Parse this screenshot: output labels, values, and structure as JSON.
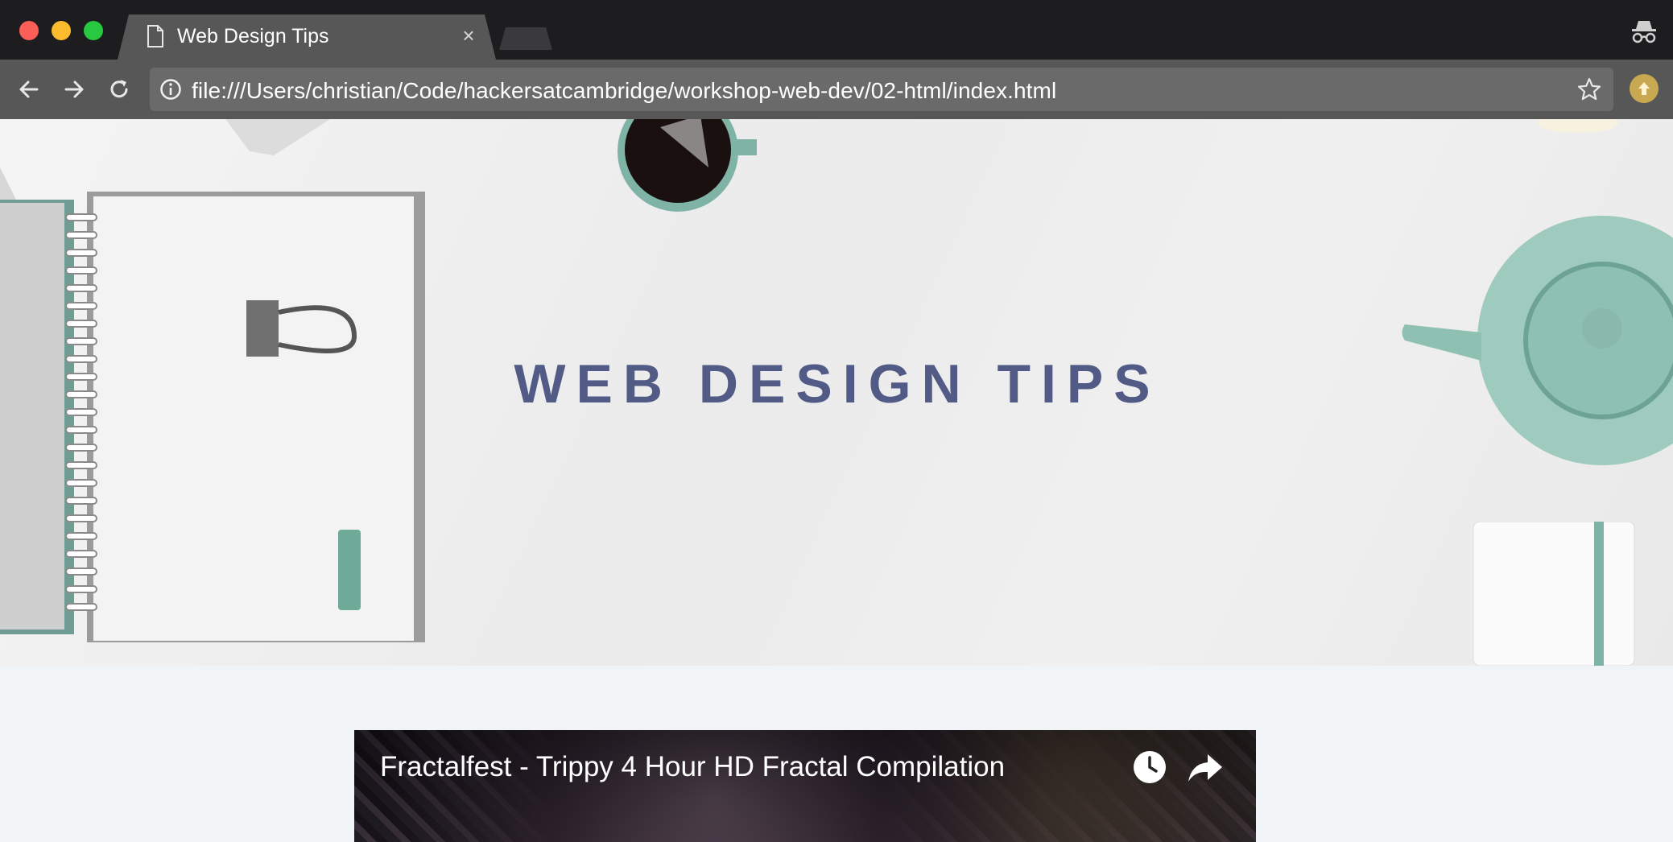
{
  "browser": {
    "tab": {
      "title": "Web Design Tips",
      "close_symbol": "×"
    },
    "address_bar": {
      "url": "file:///Users/christian/Code/hackersatcambridge/workshop-web-dev/02-html/index.html"
    },
    "icons": [
      "back-icon",
      "forward-icon",
      "reload-icon",
      "info-icon",
      "star-icon",
      "incognito-icon",
      "extension-icon",
      "document-icon",
      "close-icon"
    ],
    "colors": {
      "titlebar": "#1d1d1f",
      "toolbar": "#575757",
      "omnibox": "#6a6a6a"
    }
  },
  "page": {
    "hero": {
      "title": "WEB DESIGN TIPS",
      "title_color": "#525b86"
    },
    "video": {
      "title": "Fractalfest - Trippy 4 Hour HD Fractal Compilation",
      "icons": [
        "watch-later-icon",
        "share-icon"
      ]
    },
    "background_color": "#f0f4f7"
  }
}
